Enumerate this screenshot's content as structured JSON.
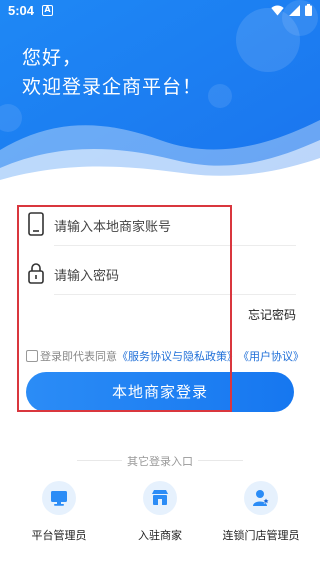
{
  "status_bar": {
    "time": "5:04",
    "notification_badge": "A"
  },
  "greeting": {
    "line1": "您好，",
    "line2": "欢迎登录企商平台！"
  },
  "form": {
    "account_placeholder": "请输入本地商家账号",
    "password_placeholder": "请输入密码",
    "forgot_label": "忘记密码",
    "agreement_prefix": "登录即代表同意",
    "service_policy_link": "《服务协议与隐私政策》",
    "user_agreement_link": "《用户协议》",
    "login_button": "本地商家登录"
  },
  "other_login": {
    "title": "其它登录入口",
    "options": [
      {
        "label": "平台管理员",
        "icon": "monitor-icon"
      },
      {
        "label": "入驻商家",
        "icon": "store-icon"
      },
      {
        "label": "连锁门店管理员",
        "icon": "user-star-icon"
      }
    ]
  },
  "colors": {
    "brand_blue": "#1677f0",
    "link_blue": "#1f6fd8",
    "highlight_red": "#d9363e"
  }
}
